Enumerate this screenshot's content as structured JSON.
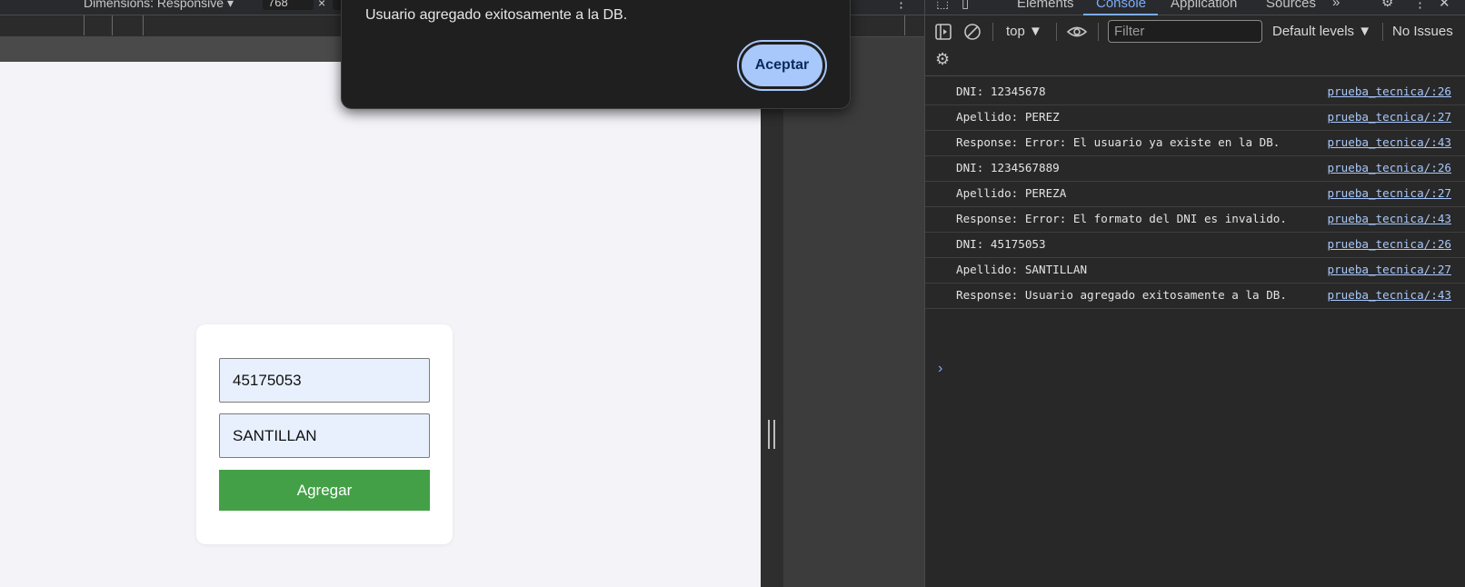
{
  "device_toolbar": {
    "dimensions_label": "Dimensions: Responsive ▾",
    "width_value": "768",
    "times": "×",
    "more": "⋮"
  },
  "page": {
    "dni_value": "45175053",
    "apellido_value": "SANTILLAN",
    "agregar_label": "Agregar"
  },
  "alert": {
    "message": "Usuario agregado exitosamente a la DB.",
    "ok_label": "Aceptar"
  },
  "devtools": {
    "tabs": [
      "Elements",
      "Console",
      "Application",
      "Sources"
    ],
    "context": "top ▼",
    "filter_placeholder": "Filter",
    "levels": "Default levels ▼",
    "issues": "No Issues",
    "accent": "#7cacf8"
  },
  "console": [
    {
      "msg": "DNI: 12345678",
      "src": "prueba_tecnica/:26"
    },
    {
      "msg": "Apellido: PEREZ",
      "src": "prueba_tecnica/:27"
    },
    {
      "msg": "Response: Error: El usuario ya existe en la DB.",
      "src": "prueba_tecnica/:43"
    },
    {
      "msg": "DNI: 1234567889",
      "src": "prueba_tecnica/:26"
    },
    {
      "msg": "Apellido: PEREZA",
      "src": "prueba_tecnica/:27"
    },
    {
      "msg": "Response: Error: El formato del DNI es invalido.",
      "src": "prueba_tecnica/:43"
    },
    {
      "msg": "DNI: 45175053",
      "src": "prueba_tecnica/:26"
    },
    {
      "msg": "Apellido: SANTILLAN",
      "src": "prueba_tecnica/:27"
    },
    {
      "msg": "Response: Usuario agregado exitosamente a la DB.",
      "src": "prueba_tecnica/:43"
    }
  ],
  "prompt": "›"
}
